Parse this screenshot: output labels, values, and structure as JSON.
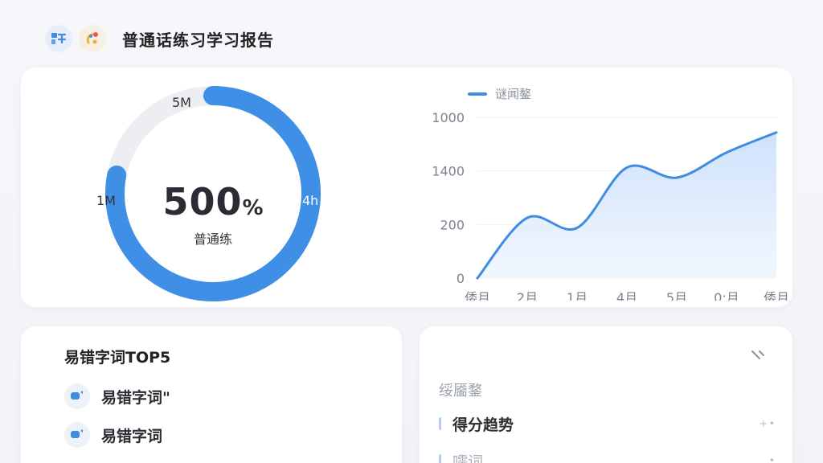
{
  "header": {
    "title": "普通话练习学习报告",
    "icons": [
      "app-logo-icon",
      "colorful-badge-icon"
    ]
  },
  "ring": {
    "value": "500",
    "unit": "%",
    "subtitle": "普通练",
    "labels": {
      "top": "5M",
      "left": "1M",
      "right": "4h"
    },
    "progress_fraction": 0.78,
    "colors": {
      "progress": "#3f8fe6",
      "track": "#eceef2"
    }
  },
  "chart_data": {
    "type": "area",
    "legend": "谜闻鏊",
    "legend_position": "top-left",
    "y_tick_labels": [
      "1000",
      "1400",
      "200",
      "0"
    ],
    "x": [
      "倭月",
      "2月",
      "1月",
      "4月",
      "5月",
      "0:月",
      "倭月"
    ],
    "values": [
      0,
      600,
      500,
      1100,
      1000,
      1250,
      1450
    ],
    "ylim": [
      0,
      1600
    ],
    "grid": true,
    "colors": {
      "line": "#3e8de0",
      "fill_top": "#cfe2fb",
      "fill_bottom": "#f2f7fe"
    }
  },
  "errors_card": {
    "title": "易错字词TOP5",
    "items": [
      {
        "label": "易错字词\""
      },
      {
        "label": "易错字词"
      }
    ]
  },
  "right_card": {
    "section_label": "绥靥鍪",
    "rows": [
      {
        "label": "得分趋势",
        "extra": "+•"
      },
      {
        "label": "嚅词",
        "extra": "•"
      }
    ]
  }
}
